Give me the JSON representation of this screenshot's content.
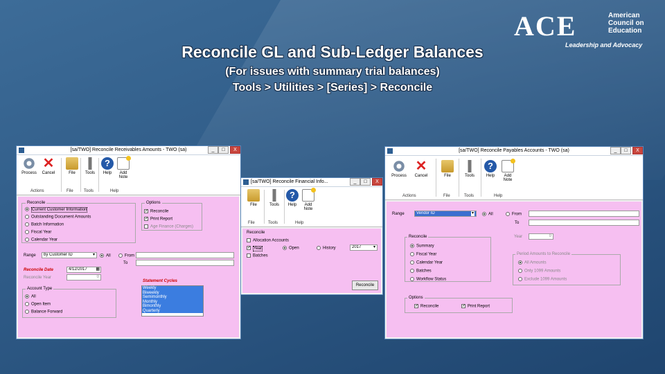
{
  "slide": {
    "title": "Reconcile GL and Sub-Ledger Balances",
    "subtitle": "(For issues with summary trial balances)",
    "path": "Tools > Utilities > [Series] > Reconcile"
  },
  "logo": {
    "ace": "ACE",
    "org_line1": "American",
    "org_line2": "Council on",
    "org_line3": "Education",
    "tagline": "Leadership and Advocacy"
  },
  "ribbon": {
    "process": "Process",
    "cancel": "Cancel",
    "file": "File",
    "tools": "Tools",
    "help": "Help",
    "add_note_1": "Add",
    "add_note_2": "Note",
    "actions": "Actions"
  },
  "receivables": {
    "title": "[sa/TWO] Reconcile Receivables Amounts  -  TWO (sa)",
    "reconcile_label": "Reconcile",
    "reconcile_options": [
      "Current Customer Information",
      "Outstanding Document Amounts",
      "Batch Information",
      "Fiscal Year",
      "Calendar Year"
    ],
    "options_label": "Options",
    "options": [
      "Reconcile",
      "Print Report",
      "Age Finance (Charges)"
    ],
    "range_label": "Range",
    "range_value": "by Customer ID",
    "all": "All",
    "from": "From",
    "to": "To",
    "reconcile_date_label": "Reconcile Date",
    "reconcile_date": "4/12/2017",
    "reconcile_year_label": "Reconcile Year",
    "reconcile_year": "0",
    "account_type_label": "Account Type",
    "account_types": [
      "All",
      "Open Item",
      "Balance Forward"
    ],
    "statement_cycles_label": "Statement Cycles",
    "statement_cycles": [
      "Weekly",
      "Biweekly",
      "Semimonthly",
      "Monthly",
      "Bimonthly",
      "Quarterly"
    ]
  },
  "financial": {
    "title": "[sa/TWO] Reconcile Financial Info...",
    "reconcile_label": "Reconcile",
    "items": [
      "Allocation Accounts",
      "Year",
      "Batches"
    ],
    "open": "Open",
    "history": "History",
    "year_value": "2017",
    "button": "Reconcile"
  },
  "payables": {
    "title": "[sa/TWO] Reconcile Payables Accounts  -  TWO (sa)",
    "range_label": "Range",
    "range_value": "Vendor ID",
    "all": "All",
    "from": "From",
    "to": "To",
    "reconcile_label": "Reconcile",
    "reconcile_options": [
      "Summary",
      "Fiscal Year",
      "Calendar Year",
      "Batches",
      "Workflow Status"
    ],
    "year_label": "Year",
    "year_value": "0",
    "period_label": "Period Amounts to Reconcile",
    "period_options": [
      "All Amounts",
      "Only 1099 Amounts",
      "Exclude 1099 Amounts"
    ],
    "options_label": "Options",
    "options": [
      "Reconcile",
      "Print Report"
    ]
  }
}
